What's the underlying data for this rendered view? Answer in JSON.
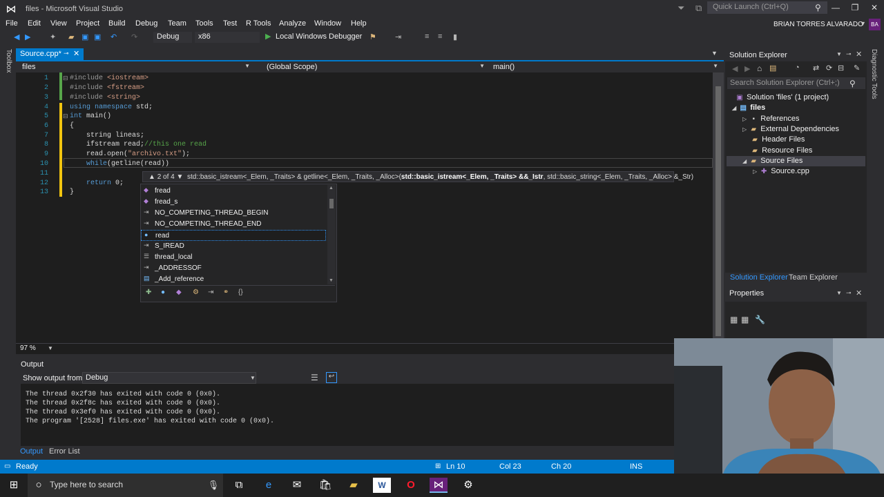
{
  "window": {
    "title": "files - Microsoft Visual Studio",
    "quick_launch": "Quick Launch (Ctrl+Q)",
    "user": "BRIAN TORRES ALVARADO",
    "avatar": "BA"
  },
  "menu": [
    "File",
    "Edit",
    "View",
    "Project",
    "Build",
    "Debug",
    "Team",
    "Tools",
    "Test",
    "R Tools",
    "Analyze",
    "Window",
    "Help"
  ],
  "toolbar": {
    "config": "Debug",
    "platform": "x86",
    "debugger": "Local Windows Debugger"
  },
  "rails": {
    "left": "Toolbox",
    "right": "Diagnostic Tools"
  },
  "doc_tab": {
    "label": "Source.cpp*"
  },
  "navbar": {
    "project": "files",
    "scope": "(Global Scope)",
    "member": "main()"
  },
  "code": {
    "lines": [
      "1",
      "2",
      "3",
      "4",
      "5",
      "6",
      "7",
      "8",
      "9",
      "10",
      "11",
      "12",
      "13"
    ]
  },
  "signature": {
    "counter": "2 of 4",
    "prefix": "std::basic_istream<_Elem, _Traits> & getline<_Elem, _Traits, _Alloc>(",
    "bold": "std::basic_istream<_Elem, _Traits> &&_Istr",
    "suffix": ", std::basic_string<_Elem, _Traits, _Alloc> &_Str)"
  },
  "completion": [
    {
      "label": "fread",
      "icon": "function-icon"
    },
    {
      "label": "fread_s",
      "icon": "function-icon"
    },
    {
      "label": "NO_COMPETING_THREAD_BEGIN",
      "icon": "macro-icon"
    },
    {
      "label": "NO_COMPETING_THREAD_END",
      "icon": "macro-icon"
    },
    {
      "label": "read",
      "icon": "variable-icon"
    },
    {
      "label": "S_IREAD",
      "icon": "macro-icon"
    },
    {
      "label": "thread_local",
      "icon": "keyword-icon"
    },
    {
      "label": "_ADDRESSOF",
      "icon": "macro-icon"
    },
    {
      "label": "_Add_reference",
      "icon": "struct-icon"
    }
  ],
  "zoom": "97 %",
  "output": {
    "title": "Output",
    "show_from_label": "Show output from:",
    "source": "Debug",
    "lines": [
      "The thread 0x2f30 has exited with code 0 (0x0).",
      "The thread 0x2f8c has exited with code 0 (0x0).",
      "The thread 0x3ef0 has exited with code 0 (0x0).",
      "The program '[2528] files.exe' has exited with code 0 (0x0)."
    ]
  },
  "bottom_tabs": [
    "Output",
    "Error List"
  ],
  "status": {
    "state": "Ready",
    "ln": "Ln 10",
    "col": "Col 23",
    "ch": "Ch 20",
    "mode": "INS"
  },
  "solution_explorer": {
    "title": "Solution Explorer",
    "search": "Search Solution Explorer (Ctrl+;)",
    "items": [
      {
        "label": "Solution 'files' (1 project)"
      },
      {
        "label": "files"
      },
      {
        "label": "References"
      },
      {
        "label": "External Dependencies"
      },
      {
        "label": "Header Files"
      },
      {
        "label": "Resource Files"
      },
      {
        "label": "Source Files"
      },
      {
        "label": "Source.cpp"
      }
    ],
    "tabs": [
      "Solution Explorer",
      "Team Explorer"
    ]
  },
  "properties": {
    "title": "Properties"
  },
  "taskbar": {
    "search": "Type here to search"
  },
  "colors": {
    "accent": "#007acc",
    "background": "#2d2d30",
    "editor": "#1e1e1e"
  }
}
